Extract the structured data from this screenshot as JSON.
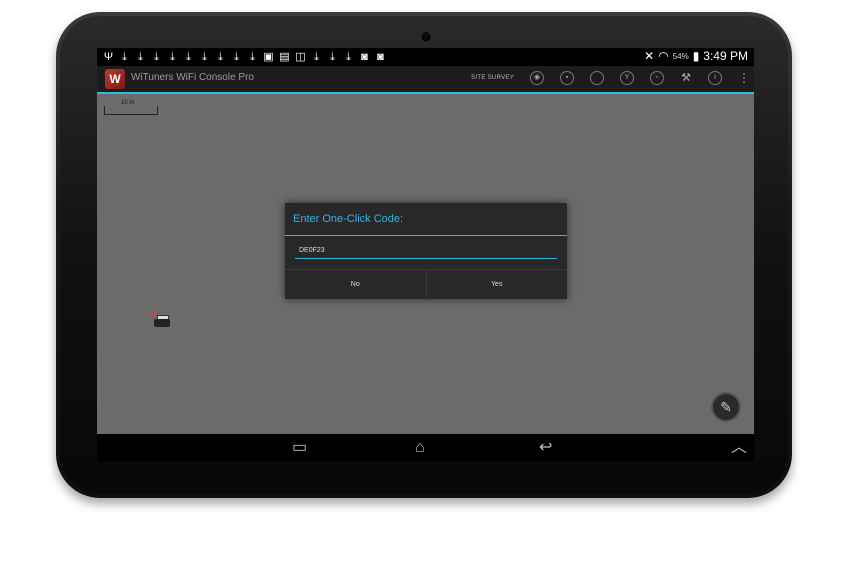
{
  "status_bar": {
    "notification_icons": [
      "usb-icon",
      "download-icon",
      "download-icon",
      "download-icon",
      "download-icon",
      "download-icon",
      "download-icon",
      "download-icon",
      "download-icon",
      "download-icon",
      "image-icon",
      "sd-icon",
      "screenshot-icon",
      "download-icon",
      "download-icon",
      "download-icon",
      "camera-icon",
      "camera-icon"
    ],
    "battery": "54%",
    "time": "3:49 PM"
  },
  "action_bar": {
    "title": "WiTuners WiFi Console Pro",
    "site_survey_label": "SITE SURVEY",
    "icons": [
      "eye-icon",
      "save-icon",
      "circle-icon",
      "antenna-icon",
      "lock-icon",
      "wrench-icon",
      "info-icon",
      "overflow-icon"
    ]
  },
  "map": {
    "scale_label": "10 m"
  },
  "dialog": {
    "title": "Enter One-Click Code:",
    "input_value": "DE0F23",
    "no_label": "No",
    "yes_label": "Yes"
  },
  "colors": {
    "accent": "#33b5e5",
    "map_bg": "#6b6b6b",
    "dialog_bg": "#282828"
  }
}
